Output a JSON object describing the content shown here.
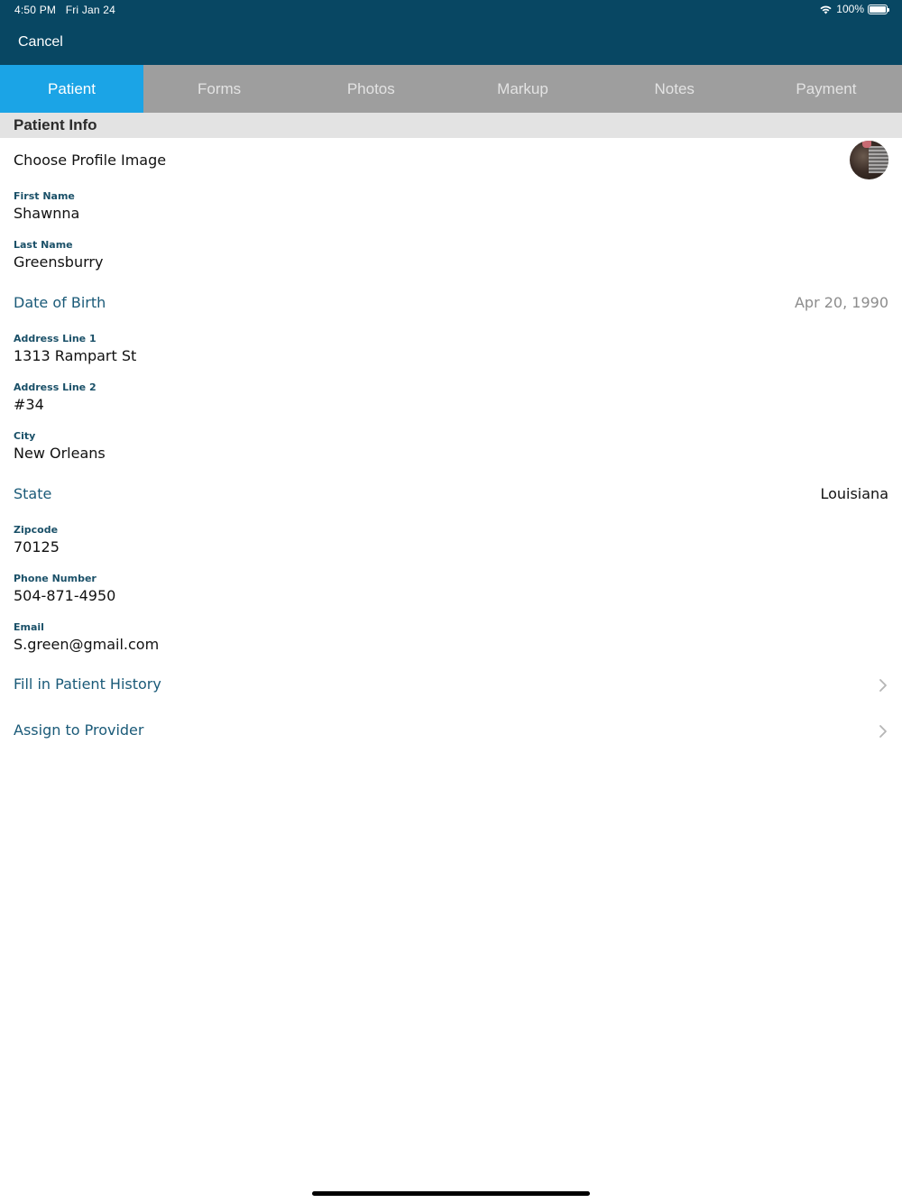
{
  "status_bar": {
    "time": "4:50 PM",
    "date": "Fri Jan 24",
    "battery": "100%"
  },
  "nav": {
    "cancel_label": "Cancel"
  },
  "tabs": [
    {
      "label": "Patient",
      "active": true
    },
    {
      "label": "Forms",
      "active": false
    },
    {
      "label": "Photos",
      "active": false
    },
    {
      "label": "Markup",
      "active": false
    },
    {
      "label": "Notes",
      "active": false
    },
    {
      "label": "Payment",
      "active": false
    }
  ],
  "section": {
    "title": "Patient Info"
  },
  "profile": {
    "label": "Choose Profile Image"
  },
  "fields": {
    "first_name": {
      "label": "First Name",
      "value": "Shawnna"
    },
    "last_name": {
      "label": "Last Name",
      "value": "Greensburry"
    },
    "address1": {
      "label": "Address Line 1",
      "value": "1313 Rampart St"
    },
    "address2": {
      "label": "Address Line 2",
      "value": "#34"
    },
    "city": {
      "label": "City",
      "value": "New Orleans"
    },
    "zipcode": {
      "label": "Zipcode",
      "value": "70125"
    },
    "phone": {
      "label": "Phone Number",
      "value": "504-871-4950"
    },
    "email": {
      "label": "Email",
      "value": "S.green@gmail.com"
    }
  },
  "dob": {
    "label": "Date of Birth",
    "value": "Apr 20, 1990"
  },
  "state": {
    "label": "State",
    "value": "Louisiana"
  },
  "links": {
    "history": "Fill in Patient History",
    "provider": "Assign to Provider"
  },
  "colors": {
    "header_bg": "#084763",
    "tab_active": "#1ba4e6",
    "tab_bg": "#9e9e9e",
    "link": "#1a5a78"
  }
}
